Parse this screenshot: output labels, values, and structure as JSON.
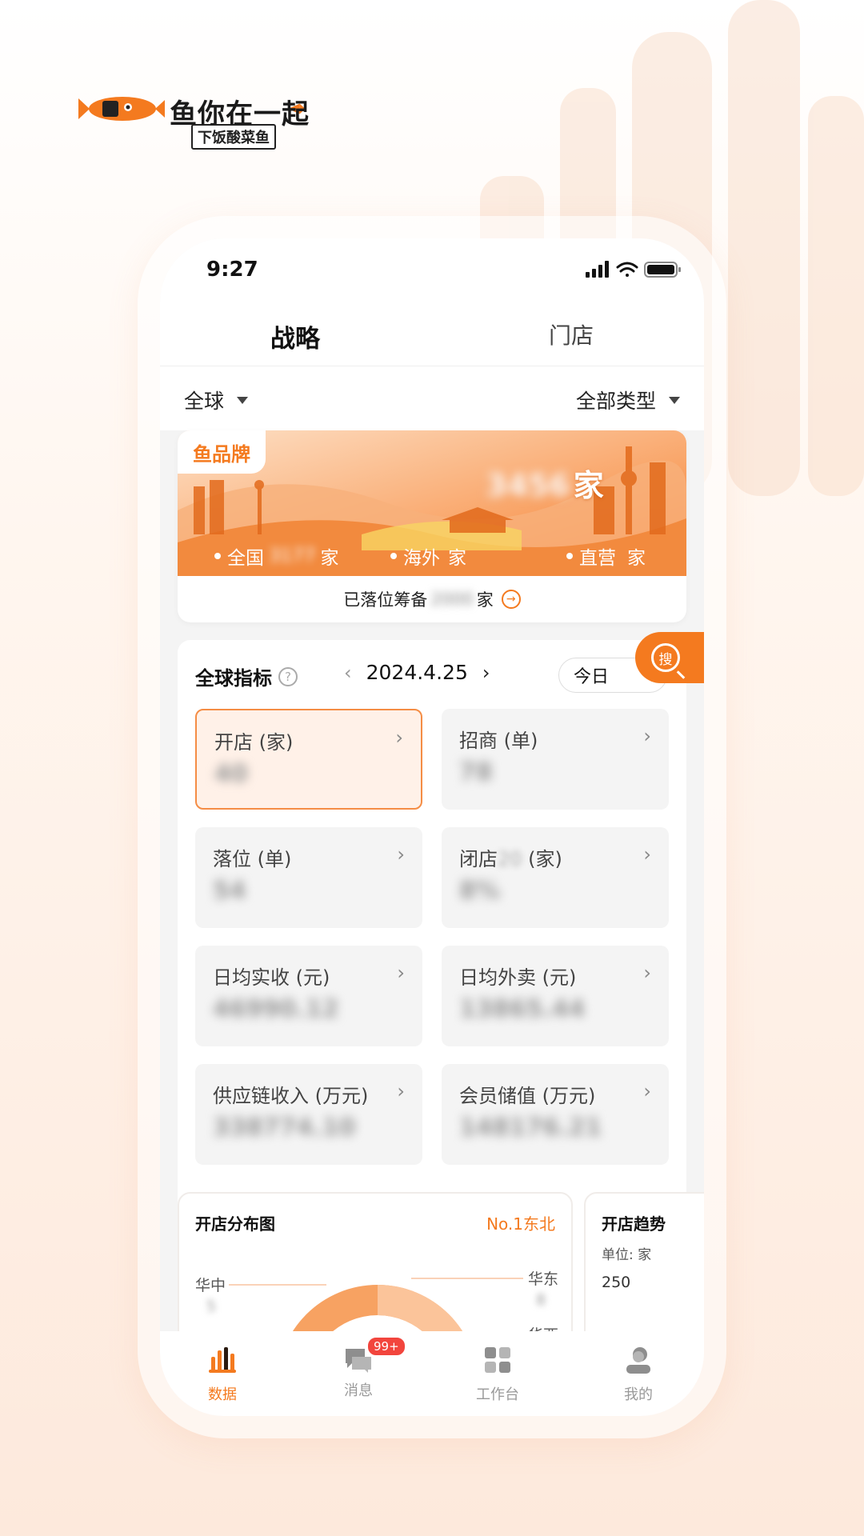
{
  "brand": {
    "name": "鱼你在一起",
    "slogan": "下饭酸菜鱼"
  },
  "status": {
    "time": "9:27"
  },
  "tabs": [
    {
      "label": "战略",
      "active": true
    },
    {
      "label": "门店",
      "active": false
    }
  ],
  "filters": {
    "region": "全球",
    "type": "全部类型"
  },
  "banner": {
    "tag": "鱼品牌",
    "total_value": "3456",
    "total_unit": "家",
    "stats": [
      {
        "label": "全国",
        "value": "3177",
        "unit": "家"
      },
      {
        "label": "海外",
        "value": "",
        "unit": "家"
      },
      {
        "label": "直营",
        "value": "",
        "unit": "家"
      }
    ],
    "footer_prefix": "已落位筹备",
    "footer_value": "2000",
    "footer_unit": "家"
  },
  "metrics": {
    "title": "全球指标",
    "help": "?",
    "prev_arrow": "‹",
    "date": "2024.4.25",
    "next_arrow": "›",
    "period": "今日",
    "search_label": "搜",
    "cards": [
      {
        "label": "开店 (家)",
        "value": "40",
        "active": true
      },
      {
        "label": "招商 (单)",
        "value": "78",
        "active": false
      },
      {
        "label": "落位 (单)",
        "value": "54",
        "active": false
      },
      {
        "label": "闭店",
        "label_hidden": "20",
        "label_suffix": " (家)",
        "value": "8%",
        "active": false
      },
      {
        "label": "日均实收 (元)",
        "value": "46990.12",
        "active": false
      },
      {
        "label": "日均外卖 (元)",
        "value": "13865.44",
        "active": false
      },
      {
        "label": "供应链收入 (万元)",
        "value": "338774.10",
        "active": false
      },
      {
        "label": "会员储值 (万元)",
        "value": "148176.21",
        "active": false
      }
    ]
  },
  "charts": {
    "distribution": {
      "title": "开店分布图",
      "top": "No.1东北",
      "labels": [
        {
          "name": "华中",
          "value": "5"
        },
        {
          "name": "华东",
          "value": "8"
        },
        {
          "name": "华西",
          "value": ""
        }
      ]
    },
    "trend": {
      "title": "开店趋势",
      "unit": "单位: 家",
      "tick": "250"
    }
  },
  "nav": [
    {
      "label": "数据",
      "active": true
    },
    {
      "label": "消息",
      "active": false,
      "badge": "99+"
    },
    {
      "label": "工作台",
      "active": false
    },
    {
      "label": "我的",
      "active": false
    }
  ],
  "colors": {
    "accent": "#f47a1f",
    "badge": "#f2453d"
  }
}
